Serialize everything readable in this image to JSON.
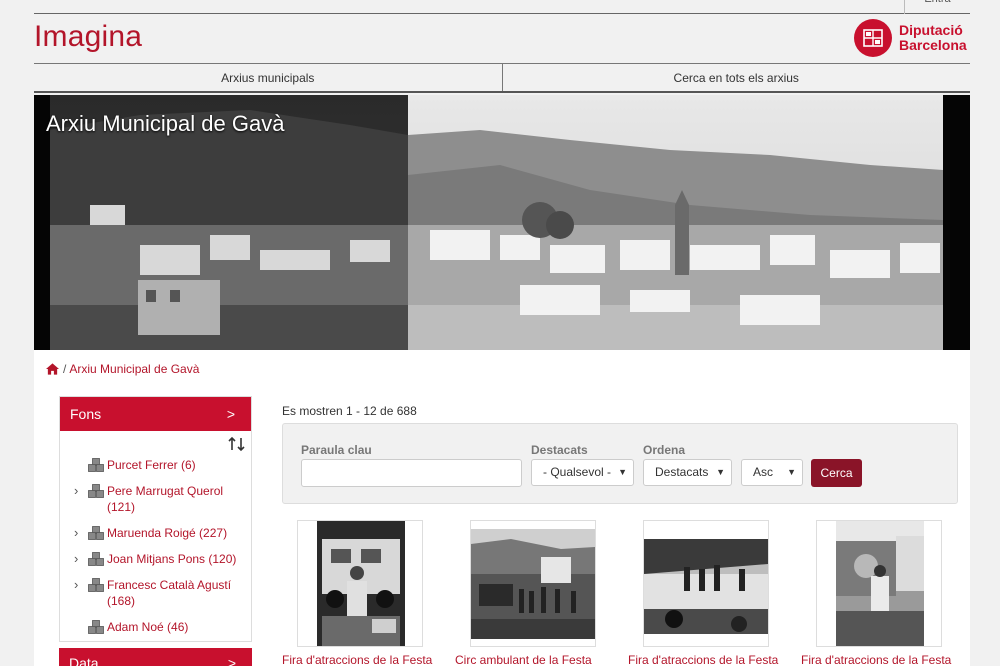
{
  "header": {
    "lang": "Entra",
    "brand": "Imagina",
    "logo_line1": "Diputació",
    "logo_line2": "Barcelona"
  },
  "nav": {
    "items": [
      "Arxius municipals",
      "Cerca en tots els arxius"
    ]
  },
  "hero": {
    "title": "Arxiu Municipal de Gavà"
  },
  "breadcrumb": {
    "sep": "/",
    "current": "Arxiu Municipal de Gavà"
  },
  "sidebar": {
    "title": "Fons",
    "chevron": ">",
    "items": [
      {
        "label": "Purcet Ferrer (6)",
        "expandable": false
      },
      {
        "label": "Pere Marrugat Querol (121)",
        "expandable": true
      },
      {
        "label": "Maruenda Roigé (227)",
        "expandable": true
      },
      {
        "label": "Joan Mitjans Pons (120)",
        "expandable": true
      },
      {
        "label": "Francesc Català Agustí (168)",
        "expandable": true
      },
      {
        "label": "Adam Noé (46)",
        "expandable": false
      }
    ],
    "next_title": "Data"
  },
  "results": {
    "summary": "Es mostren 1 - 12 de 688"
  },
  "filter": {
    "keyword_label": "Paraula clau",
    "keyword_value": "",
    "featured_label": "Destacats",
    "featured_value": "- Qualsevol -",
    "order_label": "Ordena",
    "order_value": "Destacats",
    "direction_value": "Asc",
    "search_button": "Cerca"
  },
  "cards": [
    {
      "title": "Fira d'atraccions de la Festa"
    },
    {
      "title": "Circ ambulant de la Festa"
    },
    {
      "title": "Fira d'atraccions de la Festa"
    },
    {
      "title": "Fira d'atraccions de la Festa"
    }
  ],
  "colors": {
    "accent": "#c8102e",
    "button": "#8a1428",
    "brand": "#b3152a"
  }
}
